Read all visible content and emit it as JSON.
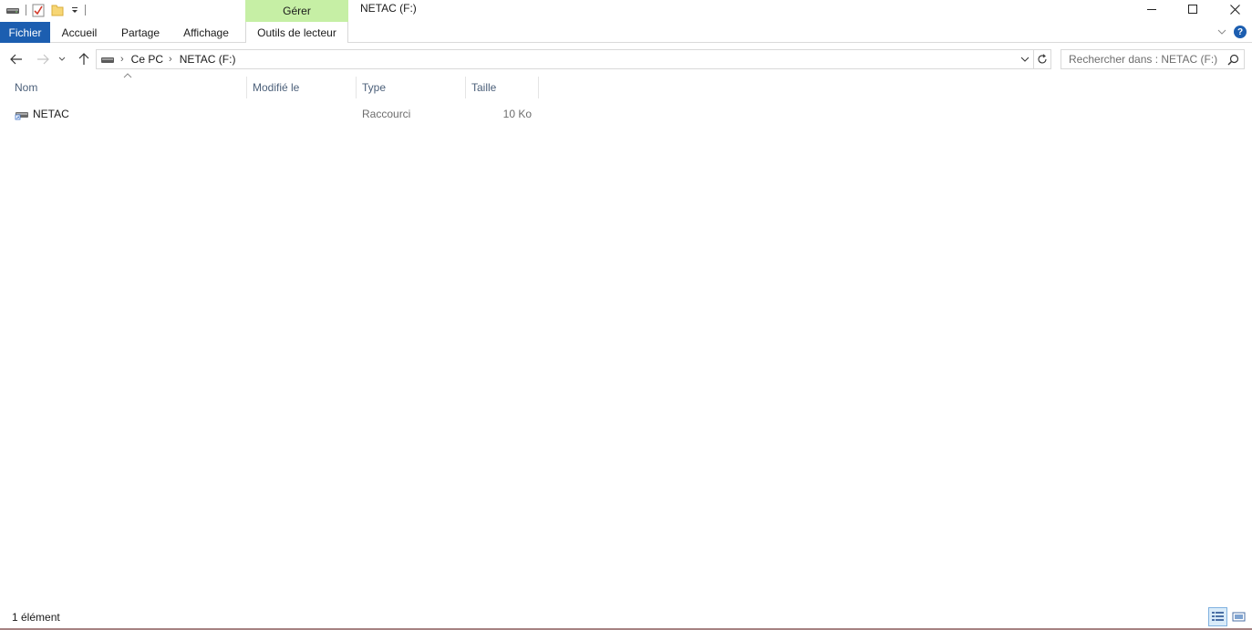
{
  "window": {
    "title": "NETAC (F:)"
  },
  "ribbon": {
    "context_group": "Gérer",
    "tabs": [
      "Fichier",
      "Accueil",
      "Partage",
      "Affichage"
    ],
    "context_tab": "Outils de lecteur"
  },
  "address": {
    "crumbs": [
      "Ce PC",
      "NETAC (F:)"
    ]
  },
  "search": {
    "placeholder": "Rechercher dans : NETAC (F:)"
  },
  "columns": [
    "Nom",
    "Modifié le",
    "Type",
    "Taille"
  ],
  "files": [
    {
      "name": "NETAC",
      "modified": "",
      "type": "Raccourci",
      "size": "10 Ko"
    }
  ],
  "status": {
    "count": "1 élément"
  },
  "colors": {
    "file_tab": "#1c5eb0",
    "context_group": "#c6efa5",
    "header_text": "#4c607a"
  }
}
